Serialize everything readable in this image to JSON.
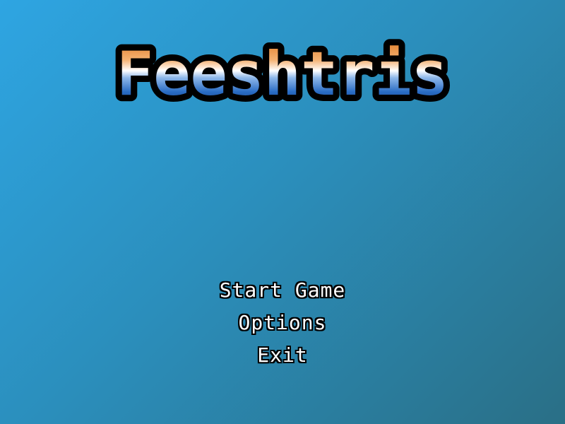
{
  "game": {
    "title": "Feeshtris"
  },
  "menu": {
    "items": [
      {
        "label": "Start Game"
      },
      {
        "label": "Options"
      },
      {
        "label": "Exit"
      }
    ]
  },
  "colors": {
    "background_start": "#2ea5e2",
    "background_end": "#2a6f86",
    "logo_top": "#f2a15a",
    "logo_mid": "#ffffff",
    "logo_bottom": "#1a4f9a",
    "logo_outline": "#000000",
    "menu_text": "#ffffff"
  }
}
